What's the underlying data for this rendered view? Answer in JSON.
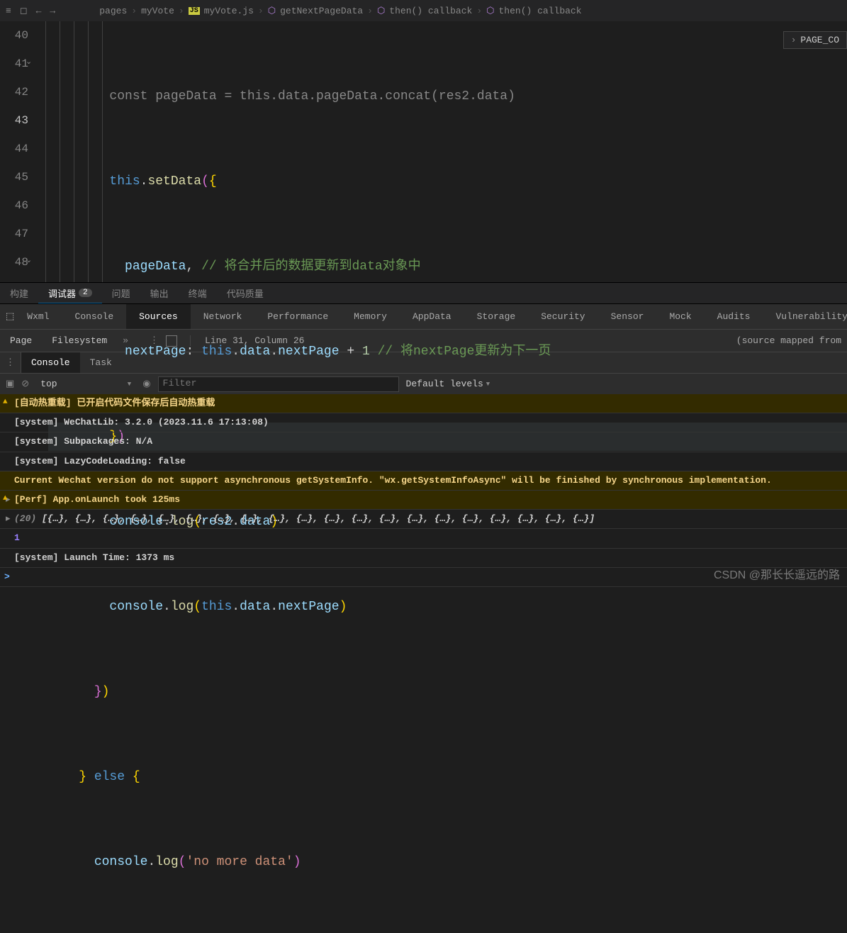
{
  "breadcrumb": {
    "p0": "pages",
    "p1": "myVote",
    "file": "myVote.js",
    "sym0": "getNextPageData",
    "sym1": "then() callback",
    "sym2": "then() callback"
  },
  "overlay": "PAGE_CO",
  "gutter": {
    "l0": "40",
    "l1": "41",
    "l2": "42",
    "l3": "43",
    "l4": "44",
    "l5": "45",
    "l6": "46",
    "l7": "47",
    "l8": "48"
  },
  "code": {
    "pre": "        const pageData = this.data.pageData.concat(res2.data)",
    "l40": {
      "indent": "        ",
      "this": "this",
      "dot": ".",
      "fn": "setData",
      "open": "(",
      "brace": "{"
    },
    "l41": {
      "indent": "          ",
      "prop": "pageData",
      "comma": ", ",
      "cmt": "// 将合并后的数据更新到data对象中"
    },
    "l42": {
      "indent": "          ",
      "prop": "nextPage",
      "colon": ": ",
      "this": "this",
      "d1": ".",
      "d2": "data",
      "d3": ".",
      "d4": "nextPage",
      "op": " + ",
      "num": "1",
      "sp": " ",
      "cmt": "// 将nextPage更新为下一页"
    },
    "l43": {
      "indent": "        ",
      "brace": "}",
      "close": ")"
    },
    "l44": {
      "indent": "        ",
      "obj": "console",
      "dot": ".",
      "fn": "log",
      "open": "(",
      "arg1": "res2",
      "d1": ".",
      "arg2": "data",
      "close": ")"
    },
    "l45": {
      "indent": "        ",
      "obj": "console",
      "dot": ".",
      "fn": "log",
      "open": "(",
      "this": "this",
      "d1": ".",
      "p1": "data",
      "d2": ".",
      "p2": "nextPage",
      "close": ")"
    },
    "l46": {
      "indent": "      ",
      "brace": "}",
      "close": ")"
    },
    "l47": {
      "indent": "    ",
      "brace": "}",
      "else": " else ",
      "brace2": "{"
    },
    "l48": {
      "indent": "      ",
      "obj": "console",
      "dot": ".",
      "fn": "log",
      "open": "(",
      "str": "'no more data'",
      "close": ")"
    }
  },
  "midtabs": {
    "t0": "构建",
    "t1": "调试器",
    "badge": "2",
    "t2": "问题",
    "t3": "输出",
    "t4": "终端",
    "t5": "代码质量"
  },
  "devtabs": {
    "t0": "Wxml",
    "t1": "Console",
    "t2": "Sources",
    "t3": "Network",
    "t4": "Performance",
    "t5": "Memory",
    "t6": "AppData",
    "t7": "Storage",
    "t8": "Security",
    "t9": "Sensor",
    "t10": "Mock",
    "t11": "Audits",
    "t12": "Vulnerability"
  },
  "srcbar": {
    "page": "Page",
    "fs": "Filesystem",
    "pos": "Line 31, Column 26",
    "mapped": "(source mapped from"
  },
  "constabs": {
    "t0": "Console",
    "t1": "Task"
  },
  "toolbar": {
    "scope": "top",
    "filter_ph": "Filter",
    "levels": "Default levels"
  },
  "log": {
    "r0": "[自动热重载] 已开启代码文件保存后自动热重载",
    "r1": "[system] WeChatLib: 3.2.0 (2023.11.6 17:13:08)",
    "r2": "[system] Subpackages: N/A",
    "r3": "[system] LazyCodeLoading: false",
    "r4": "Current Wechat version do not support asynchronous getSystemInfo. \"wx.getSystemInfoAsync\" will be finished by synchronous implementation.",
    "r5": "[Perf] App.onLaunch took 125ms",
    "r6_count": "(20)",
    "r6_body": " [{…}, {…}, {…}, {…}, {…}, {…}, {…}, {…}, {…}, {…}, {…}, {…}, {…}, {…}, {…}, {…}, {…}, {…}, {…}, {…}]",
    "r7": "1",
    "r8": "[system] Launch Time: 1373 ms"
  },
  "watermark": "CSDN @那长长遥远的路"
}
